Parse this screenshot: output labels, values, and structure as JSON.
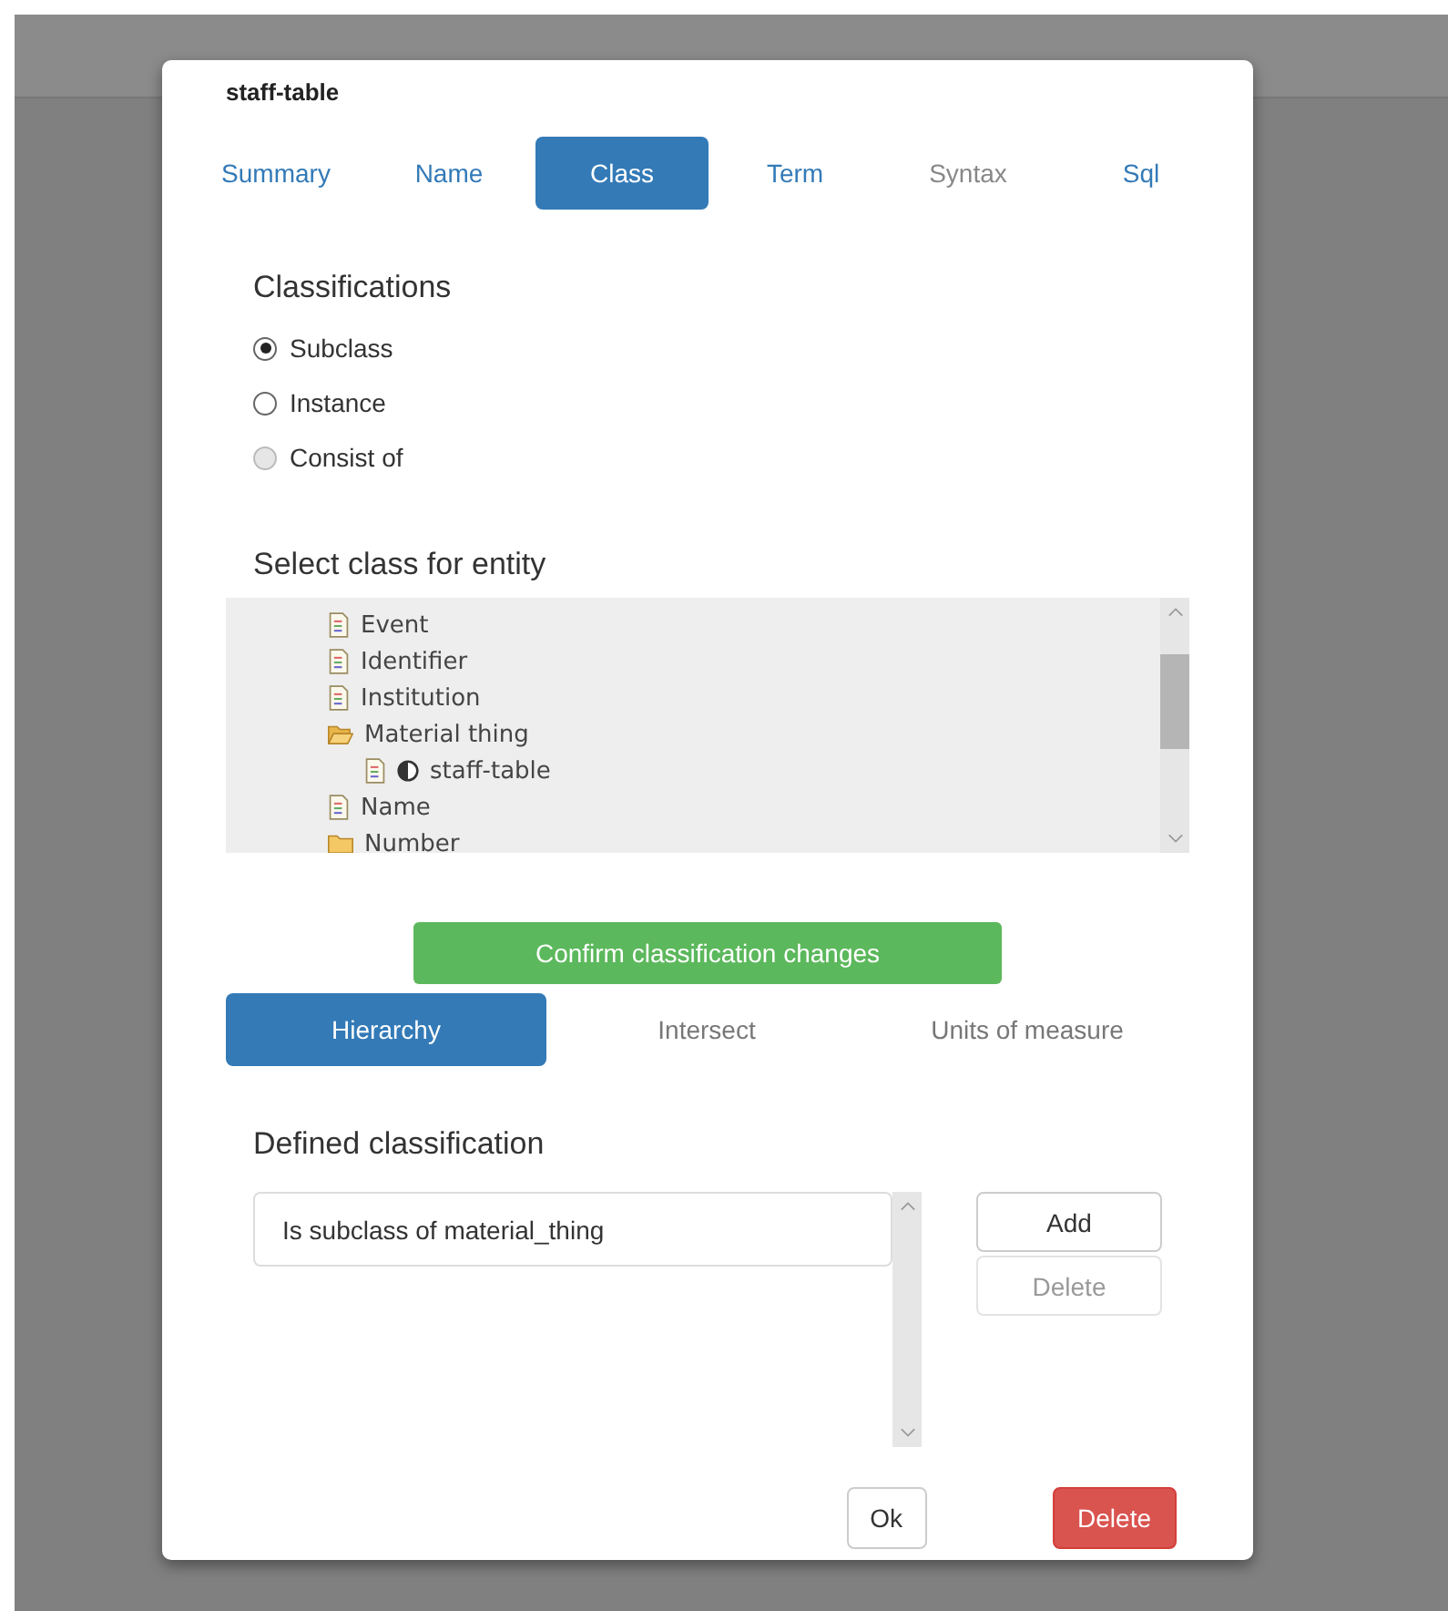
{
  "dialog": {
    "title": "staff-table"
  },
  "tabs": [
    {
      "label": "Summary",
      "selected": false,
      "disabled": false
    },
    {
      "label": "Name",
      "selected": false,
      "disabled": false
    },
    {
      "label": "Class",
      "selected": true,
      "disabled": false
    },
    {
      "label": "Term",
      "selected": false,
      "disabled": false
    },
    {
      "label": "Syntax",
      "selected": false,
      "disabled": true
    },
    {
      "label": "Sql",
      "selected": false,
      "disabled": false
    }
  ],
  "classifications": {
    "heading": "Classifications",
    "options": [
      {
        "label": "Subclass",
        "selected": true,
        "disabled": false
      },
      {
        "label": "Instance",
        "selected": false,
        "disabled": false
      },
      {
        "label": "Consist of",
        "selected": false,
        "disabled": true
      }
    ]
  },
  "class_tree": {
    "heading": "Select class for entity",
    "items": [
      {
        "label": "Event",
        "kind": "doc"
      },
      {
        "label": "Identifier",
        "kind": "doc"
      },
      {
        "label": "Institution",
        "kind": "doc"
      },
      {
        "label": "Material thing",
        "kind": "folder",
        "expanded": true,
        "children": [
          {
            "label": "staff-table",
            "kind": "doc",
            "current": true
          }
        ]
      },
      {
        "label": "Name",
        "kind": "doc"
      },
      {
        "label": "Number",
        "kind": "folder",
        "expanded": false
      }
    ]
  },
  "confirm_button": "Confirm classification changes",
  "subtabs": [
    {
      "label": "Hierarchy",
      "selected": true
    },
    {
      "label": "Intersect",
      "selected": false
    },
    {
      "label": "Units of measure",
      "selected": false
    }
  ],
  "defined": {
    "heading": "Defined classification",
    "items": [
      "Is subclass of material_thing"
    ],
    "buttons": [
      {
        "label": "Add",
        "disabled": false
      },
      {
        "label": "Delete",
        "disabled": true
      }
    ]
  },
  "footer": [
    {
      "label": "Ok",
      "kind": "default"
    },
    {
      "label": "Delete",
      "kind": "danger"
    }
  ]
}
